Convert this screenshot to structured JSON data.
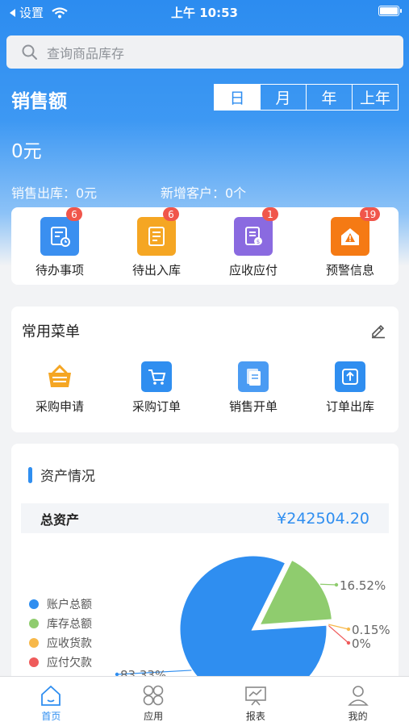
{
  "status_bar": {
    "back_label": "设置",
    "time": "上午 10:53"
  },
  "search": {
    "placeholder": "查询商品库存"
  },
  "sales": {
    "title": "销售额",
    "tabs": [
      {
        "label": "日",
        "active": true
      },
      {
        "label": "月",
        "active": false
      },
      {
        "label": "年",
        "active": false
      },
      {
        "label": "上年",
        "active": false
      }
    ],
    "amount": "0元",
    "outbound": "销售出库：0元",
    "new_customers": "新增客户：0个"
  },
  "quick": [
    {
      "label": "待办事项",
      "badge": "6",
      "color": "#3a8ff0",
      "icon": "todo-icon"
    },
    {
      "label": "待出入库",
      "badge": "6",
      "color": "#f5a623",
      "icon": "warehouse-icon"
    },
    {
      "label": "应收应付",
      "badge": "1",
      "color": "#8a6ae0",
      "icon": "receivable-icon"
    },
    {
      "label": "预警信息",
      "badge": "19",
      "color": "#f57a14",
      "icon": "warning-icon"
    }
  ],
  "menu": {
    "title": "常用菜单",
    "items": [
      {
        "label": "采购申请",
        "icon": "basket-icon"
      },
      {
        "label": "采购订单",
        "icon": "cart-icon"
      },
      {
        "label": "销售开单",
        "icon": "sales-doc-icon"
      },
      {
        "label": "订单出库",
        "icon": "export-icon"
      }
    ]
  },
  "assets": {
    "title": "资产情况",
    "total_label": "总资产",
    "total_value": "¥242504.20"
  },
  "chart_data": {
    "type": "pie",
    "labels": [
      "账户总额",
      "库存总额",
      "应收货款",
      "应付欠款"
    ],
    "values": [
      83.33,
      16.52,
      0.15,
      0
    ],
    "value_labels": [
      "83.33%",
      "16.52%",
      "0.15%",
      "0%"
    ],
    "colors": [
      "#2f8ef0",
      "#8fcc6e",
      "#f7b84a",
      "#ef5b5b"
    ],
    "legend_position": "left"
  },
  "tabbar": [
    {
      "label": "首页",
      "active": true,
      "icon": "home-icon"
    },
    {
      "label": "应用",
      "active": false,
      "icon": "apps-icon"
    },
    {
      "label": "报表",
      "active": false,
      "icon": "report-icon"
    },
    {
      "label": "我的",
      "active": false,
      "icon": "profile-icon"
    }
  ]
}
